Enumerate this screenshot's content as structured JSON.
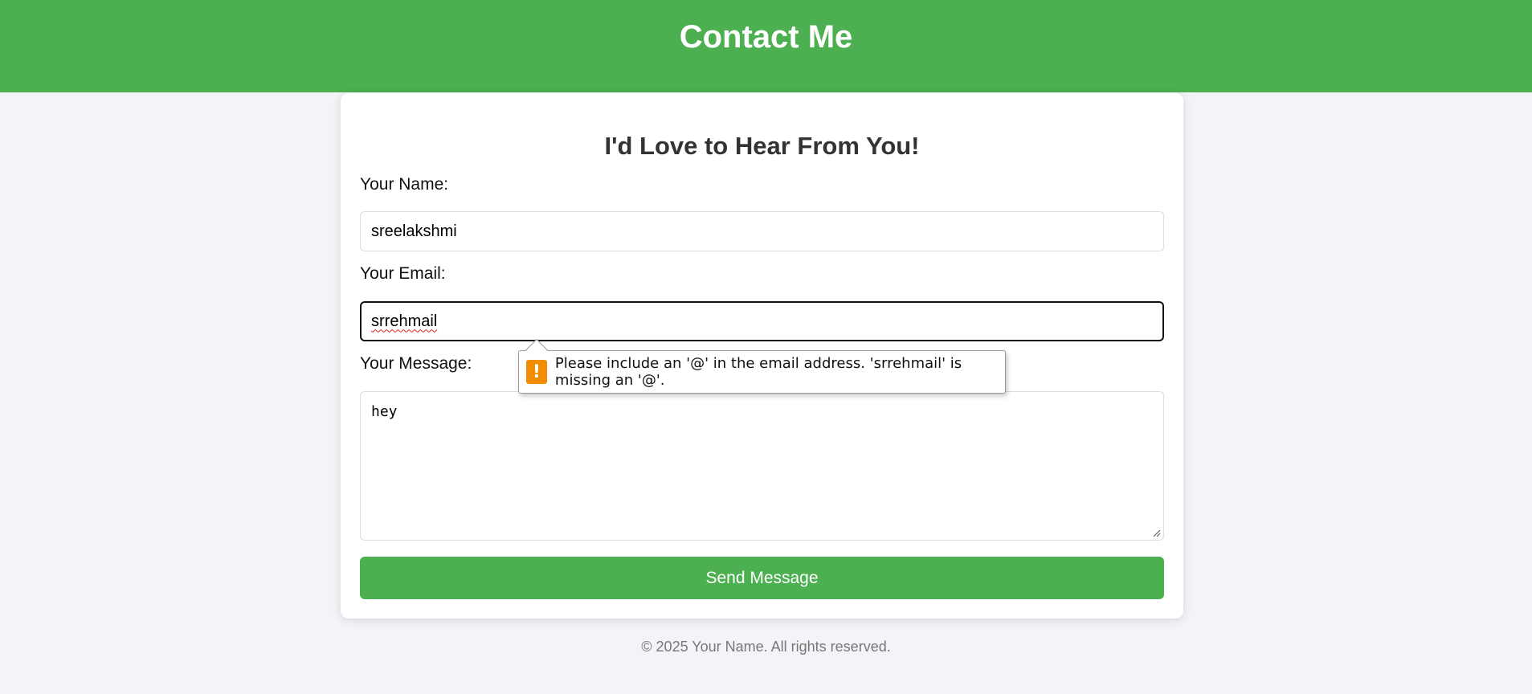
{
  "header": {
    "title": "Contact Me"
  },
  "form": {
    "heading": "I'd Love to Hear From You!",
    "name_label": "Your Name:",
    "name_value": "sreelakshmi",
    "email_label": "Your Email:",
    "email_value": "srrehmail",
    "message_label": "Your Message:",
    "message_value": "hey",
    "submit_label": "Send Message"
  },
  "validation_tooltip": {
    "icon": "warning-icon",
    "icon_glyph": "!",
    "message": "Please include an '@' in the email address. 'srrehmail' is missing an '@'."
  },
  "footer": {
    "text": "© 2025 Your Name. All rights reserved."
  },
  "colors": {
    "brand_green": "#4caf50",
    "page_background": "#f4f4f8",
    "warning_orange": "#f28c00"
  }
}
